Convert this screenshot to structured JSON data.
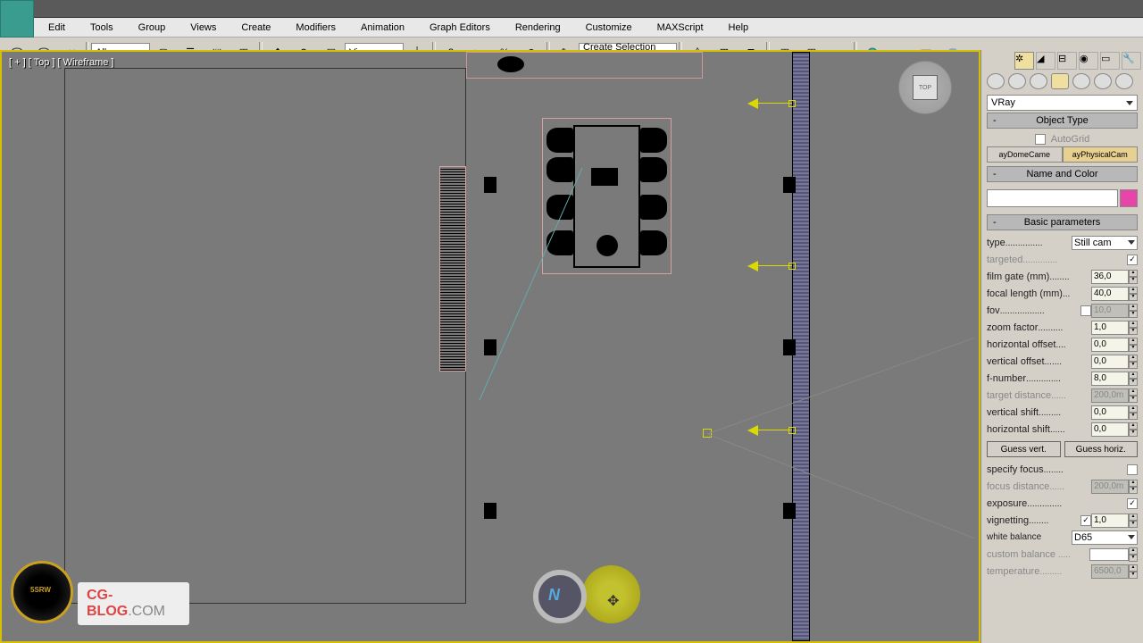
{
  "menus": [
    "Edit",
    "Tools",
    "Group",
    "Views",
    "Create",
    "Modifiers",
    "Animation",
    "Graph Editors",
    "Rendering",
    "Customize",
    "MAXScript",
    "Help"
  ],
  "toolbar": {
    "sel_filter": "All",
    "ref_sys": "View",
    "named_sel": "Create Selection Se"
  },
  "viewport": {
    "label": "[ + ] [ Top ] [ Wireframe ]",
    "cube": "TOP"
  },
  "panel": {
    "renderer": "VRay",
    "rollouts": {
      "objtype": "Object Type",
      "autogrid": "AutoGrid",
      "namecolor": "Name and Color",
      "basic": "Basic parameters"
    },
    "cam_btns": {
      "dome": "ayDomeCame",
      "phys": "ayPhysicalCam"
    },
    "params": {
      "type_label": "type",
      "type_val": "Still cam",
      "targeted": "targeted",
      "targeted_chk": "✓",
      "filmgate_l": "film gate (mm)",
      "filmgate_v": "36,0",
      "focallen_l": "focal length (mm)",
      "focallen_v": "40,0",
      "fov_l": "fov",
      "fov_v": "10,0",
      "zoom_l": "zoom factor",
      "zoom_v": "1,0",
      "hoff_l": "horizontal offset",
      "hoff_v": "0,0",
      "voff_l": "vertical offset",
      "voff_v": "0,0",
      "fnum_l": "f-number",
      "fnum_v": "8,0",
      "tdist_l": "target distance",
      "tdist_v": "200,0m",
      "vshift_l": "vertical shift",
      "vshift_v": "0,0",
      "hshift_l": "horizontal shift",
      "hshift_v": "0,0",
      "guess_v": "Guess vert.",
      "guess_h": "Guess horiz.",
      "specfocus_l": "specify focus",
      "focusdist_l": "focus distance",
      "focusdist_v": "200,0m",
      "exposure_l": "exposure",
      "exposure_chk": "✓",
      "vignette_l": "vignetting",
      "vignette_chk": "✓",
      "vignette_v": "1,0",
      "wb_l": "white balance",
      "wb_v": "D65",
      "cb_l": "custom balance",
      "temp_l": "temperature",
      "temp_v": "6500,0"
    }
  },
  "watermark": {
    "brand": "CG-BLOG",
    "tld": ".COM",
    "badge": "5SRW"
  }
}
